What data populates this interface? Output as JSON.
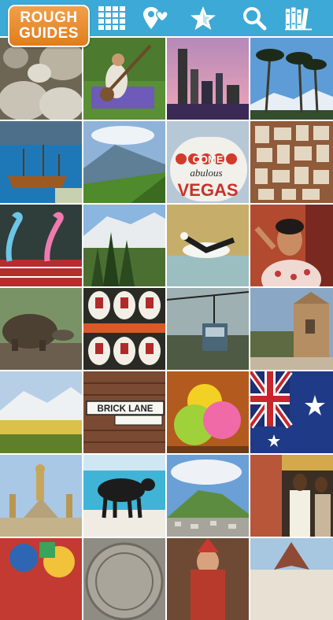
{
  "app": {
    "logo_line1": "ROUGH",
    "logo_line2": "GUIDES"
  },
  "toolbar": {
    "icons": [
      "grid-icon",
      "map-pin-heart-icon",
      "star-icon",
      "search-icon",
      "books-icon"
    ]
  },
  "colors": {
    "topbar": "#3da9d6",
    "logo": "#e8891f",
    "icon": "#ffffff"
  },
  "tiles": {
    "brick_lane_sign": "BRICK LANE",
    "vegas_sign_top": "COME",
    "vegas_sign_mid": "abulous",
    "vegas_sign_bottom": "VEGAS"
  }
}
